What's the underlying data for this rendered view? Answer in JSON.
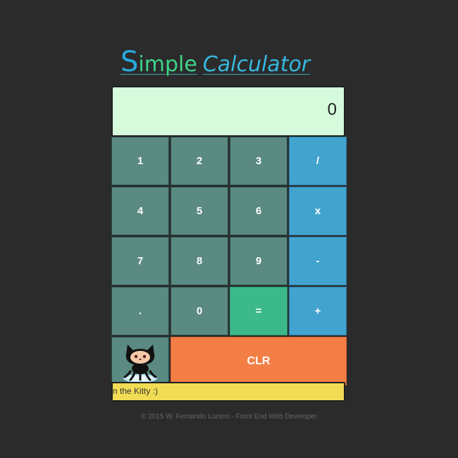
{
  "header": {
    "title_first_letter": "S",
    "title_rest_first": "imple",
    "title_second": "Calculator"
  },
  "display": {
    "value": "0"
  },
  "keypad": {
    "rows": [
      [
        {
          "label": "1",
          "kind": "num"
        },
        {
          "label": "2",
          "kind": "num"
        },
        {
          "label": "3",
          "kind": "num"
        },
        {
          "label": "/",
          "kind": "op"
        }
      ],
      [
        {
          "label": "4",
          "kind": "num"
        },
        {
          "label": "5",
          "kind": "num"
        },
        {
          "label": "6",
          "kind": "num"
        },
        {
          "label": "x",
          "kind": "op"
        }
      ],
      [
        {
          "label": "7",
          "kind": "num"
        },
        {
          "label": "8",
          "kind": "num"
        },
        {
          "label": "9",
          "kind": "num"
        },
        {
          "label": "-",
          "kind": "op"
        }
      ],
      [
        {
          "label": ".",
          "kind": "num"
        },
        {
          "label": "0",
          "kind": "num"
        },
        {
          "label": "=",
          "kind": "eq"
        },
        {
          "label": "+",
          "kind": "op"
        }
      ]
    ],
    "clear_label": "CLR",
    "kitty_icon": "octocat-icon"
  },
  "marquee": {
    "text": "n the Kitty :)"
  },
  "footer": {
    "text": "© 2015 W. Fernando Lucero - Front End Web Developer"
  },
  "colors": {
    "background": "#2b2b2b",
    "display_bg": "#d6fbdc",
    "number_key": "#5a8a82",
    "operator_key": "#42a3cf",
    "equals_key": "#3cb98a",
    "clear_key": "#f47f46",
    "marquee_bg": "#f2dc55"
  }
}
